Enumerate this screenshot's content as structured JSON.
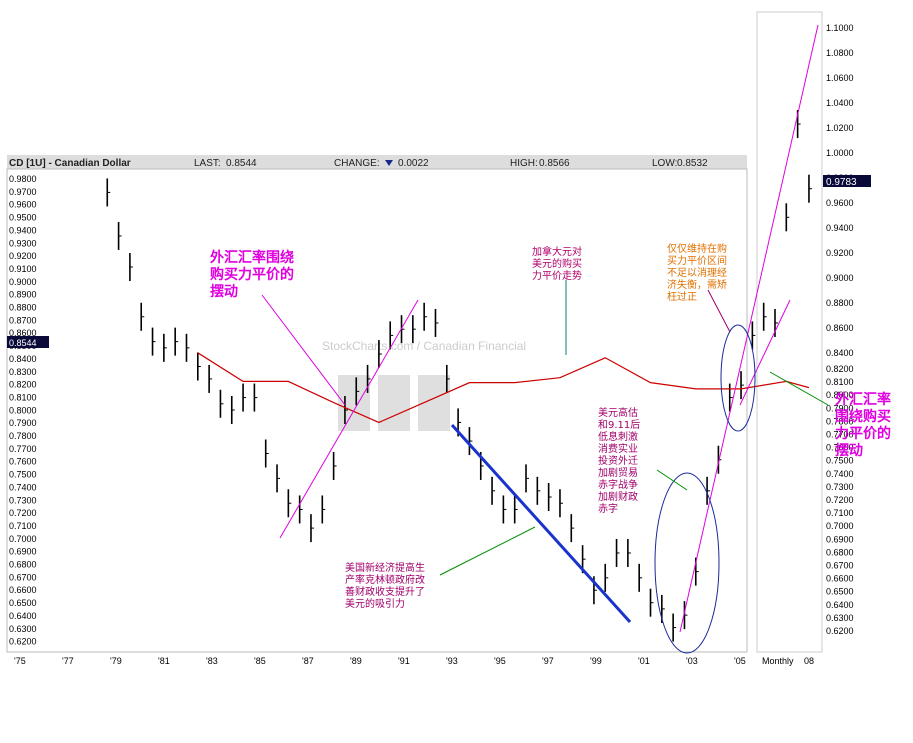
{
  "header": {
    "title": "CD [1U] - Canadian Dollar",
    "last_label": "LAST:",
    "last_value": "0.8544",
    "change_label": "CHANGE:",
    "change_value": "0.0022",
    "high_label": "HIGH:",
    "high_value": "0.8566",
    "low_label": "LOW:",
    "low_value": "0.8532"
  },
  "watermark": "StockCharts.com / Canadian Financial",
  "colors": {
    "price_bars": "#000000",
    "moving_average": "#cc0000",
    "trend_blue": "#1a33cc",
    "annotation_magenta": "#e000e0",
    "annotation_orange": "#e07000",
    "annotation_purple": "#a0006a",
    "circle_navy": "#1a2a9c",
    "current_marker": "#0a0a3a"
  },
  "chart_data": {
    "type": "bar",
    "subtype": "ohlc-price-bars",
    "series": [
      {
        "name": "",
        "x": [
          1977.0,
          1977.5,
          1978.0,
          1978.5,
          1979.0,
          1979.5,
          1980.0,
          1980.5,
          1981.0,
          1981.5,
          1982.0,
          1982.5,
          1983.0,
          1983.5,
          1984.0,
          1984.5,
          1985.0,
          1985.5,
          1986.0,
          1986.5,
          1987.0,
          1987.5,
          1988.0,
          1988.5,
          1989.0,
          1989.5,
          1990.0,
          1990.5,
          1991.0,
          1991.5,
          1992.0,
          1992.5,
          1993.0,
          1993.5,
          1994.0,
          1994.5,
          1995.0,
          1995.5,
          1996.0,
          1996.5,
          1997.0,
          1997.5,
          1998.0,
          1998.5,
          1999.0,
          1999.5,
          2000.0,
          2000.5,
          2001.0,
          2001.5,
          2002.0,
          2002.5,
          2003.0,
          2003.5,
          2004.0,
          2004.5,
          2005.0,
          2005.5,
          2006.0,
          2006.5,
          2007.0,
          2007.5,
          2008.0
        ],
        "values": [
          0.975,
          0.94,
          0.915,
          0.875,
          0.855,
          0.85,
          0.855,
          0.85,
          0.835,
          0.825,
          0.805,
          0.8,
          0.81,
          0.81,
          0.765,
          0.745,
          0.725,
          0.72,
          0.705,
          0.72,
          0.755,
          0.8,
          0.815,
          0.825,
          0.845,
          0.86,
          0.865,
          0.865,
          0.875,
          0.87,
          0.825,
          0.79,
          0.775,
          0.755,
          0.735,
          0.72,
          0.72,
          0.745,
          0.735,
          0.73,
          0.725,
          0.705,
          0.68,
          0.655,
          0.665,
          0.685,
          0.685,
          0.665,
          0.645,
          0.64,
          0.625,
          0.635,
          0.67,
          0.735,
          0.76,
          0.81,
          0.82,
          0.86,
          0.875,
          0.87,
          0.955,
          1.03,
          0.978
        ]
      },
      {
        "name": "",
        "x": [
          1981,
          1983,
          1985,
          1987,
          1989,
          1991,
          1993,
          1995,
          1997,
          1999,
          2001,
          2003,
          2005,
          2007,
          2008
        ],
        "values": [
          0.846,
          0.823,
          0.823,
          0.806,
          0.79,
          0.806,
          0.822,
          0.822,
          0.826,
          0.842,
          0.822,
          0.817,
          0.817,
          0.823,
          0.818
        ]
      }
    ],
    "x_ticks": [
      "'75",
      "'77",
      "'79",
      "'81",
      "'83",
      "'85",
      "'87",
      "'89",
      "'91",
      "'93",
      "'95",
      "'97",
      "'99",
      "'01",
      "'03",
      "'05",
      "Monthly",
      "08"
    ],
    "y_ticks_right": [
      "1.1000",
      "1.0800",
      "1.0600",
      "1.0400",
      "1.0200",
      "1.0000",
      "0.9800",
      "0.9600",
      "0.9400",
      "0.9200",
      "0.9000",
      "0.8800",
      "0.8600",
      "0.8400",
      "0.8200",
      "0.8100",
      "0.8000",
      "0.7900",
      "0.7800",
      "0.7700",
      "0.7600",
      "0.7500",
      "0.7400",
      "0.7300",
      "0.7200",
      "0.7100",
      "0.7000",
      "0.6900",
      "0.6800",
      "0.6700",
      "0.6600",
      "0.6500",
      "0.6400",
      "0.6300",
      "0.6200"
    ],
    "y_ticks_left": [
      "0.9800",
      "0.9700",
      "0.9600",
      "0.9500",
      "0.9400",
      "0.9300",
      "0.9200",
      "0.9100",
      "0.9000",
      "0.8900",
      "0.8800",
      "0.8700",
      "0.8600",
      "0.8500",
      "0.8400",
      "0.8300",
      "0.8200",
      "0.8100",
      "0.8000",
      "0.7900",
      "0.7800",
      "0.7700",
      "0.7600",
      "0.7500",
      "0.7400",
      "0.7300",
      "0.7200",
      "0.7100",
      "0.7000",
      "0.6900",
      "0.6800",
      "0.6700",
      "0.6600",
      "0.6500",
      "0.6400",
      "0.6300",
      "0.6200"
    ],
    "current_value_right": "0.9783",
    "current_value_left": "0.8544",
    "xlim": [
      1975,
      2008.4
    ],
    "ylim": [
      0.615,
      0.985
    ],
    "grid": false
  },
  "annotations": {
    "ppp_left": [
      "外汇汇率围绕",
      "购买力平价的",
      "摆动"
    ],
    "ppp_right": [
      "外汇汇率",
      "围绕购买",
      "力平价的",
      "摆动"
    ],
    "canada_ppp": [
      "加拿大元对",
      "美元的购买",
      "力平价走势"
    ],
    "orange_note": [
      "仅仅维持在购",
      "买力平价区间",
      "不足以消理经",
      "济失衡，需矫",
      "枉过正"
    ],
    "usd_high_note": [
      "美元高估",
      "和9.11后",
      "低息刺激",
      "消费实业",
      "投资外迁",
      "加剧贸易",
      "赤字战争",
      "加剧财政",
      "赤字"
    ],
    "us_econ_note": [
      "美国新经济提高生",
      "产率克林顿政府改",
      "善财政收支提升了",
      "美元的吸引力"
    ]
  }
}
